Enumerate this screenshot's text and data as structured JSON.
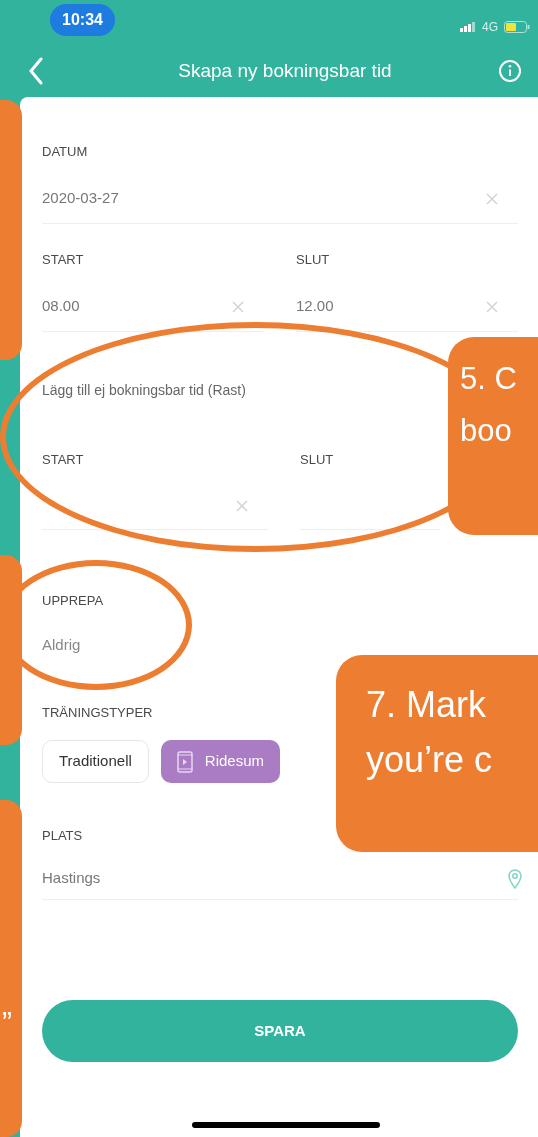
{
  "status_bar": {
    "time": "10:34",
    "network": "4G"
  },
  "nav": {
    "title": "Skapa ny bokningsbar tid"
  },
  "date_field": {
    "label": "DATUM",
    "value": "2020-03-27",
    "clear_button": true
  },
  "time_fields": [
    {
      "label": "START",
      "value": "08.00",
      "clear_button": true
    },
    {
      "label": "SLUT",
      "value": "12.00",
      "clear_button": true
    }
  ],
  "break_section": {
    "title": "Lägg till ej bokningsbar tid (Rast)",
    "fields": [
      {
        "label": "START",
        "clear_button": true
      },
      {
        "label": "SLUT",
        "clear_button": false
      }
    ]
  },
  "repeat_field": {
    "label": "UPPREPA",
    "value": "Aldrig"
  },
  "training_types": {
    "label": "TRÄNINGSTYPER",
    "options": [
      {
        "label": "Traditionell",
        "kind": "plain",
        "selected": false
      },
      {
        "label": "Ridesum",
        "kind": "app",
        "selected": true
      }
    ]
  },
  "place_field": {
    "label": "PLATS",
    "value": "Hastings"
  },
  "save_button": {
    "label": "SPARA"
  },
  "annotations": [
    {
      "kind": "box"
    },
    {
      "kind": "ellipse"
    },
    {
      "kind": "callout",
      "lines": [
        "5. C",
        "boo"
      ]
    },
    {
      "kind": "box"
    },
    {
      "kind": "ellipse"
    },
    {
      "kind": "callout",
      "lines": [
        "7. Mark",
        "you’re c"
      ]
    },
    {
      "kind": "box",
      "lines": [
        "”"
      ]
    }
  ]
}
